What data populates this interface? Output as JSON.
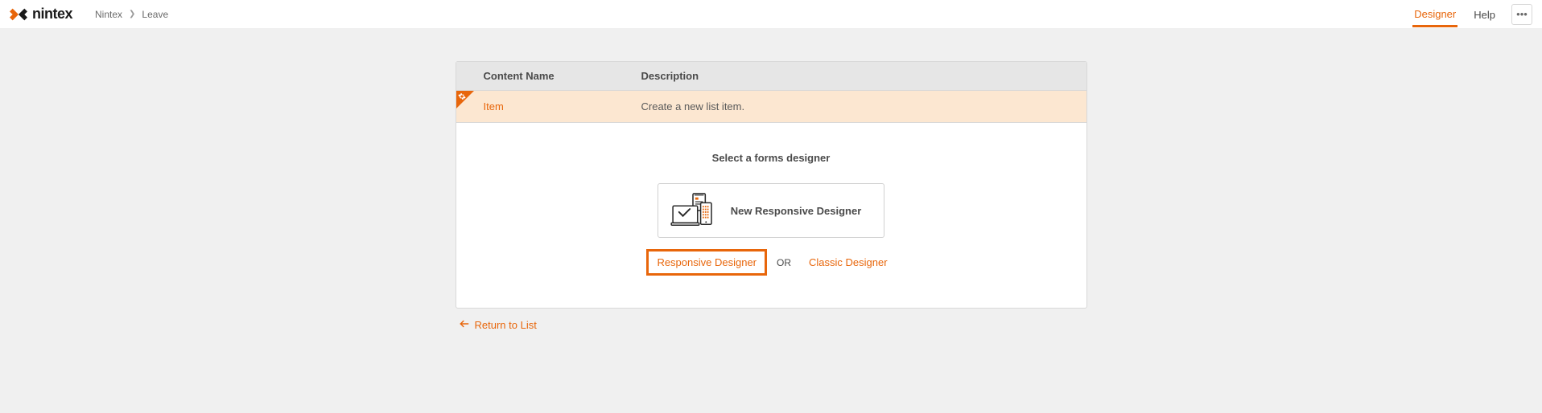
{
  "header": {
    "brand": "nintex",
    "breadcrumb": {
      "root": "Nintex",
      "current": "Leave"
    },
    "nav": {
      "designer": "Designer",
      "help": "Help"
    }
  },
  "table": {
    "headers": {
      "name": "Content Name",
      "description": "Description"
    },
    "row": {
      "name": "Item",
      "description": "Create a new list item."
    }
  },
  "panel": {
    "title": "Select a forms designer",
    "newResponsive": "New Responsive Designer",
    "responsive": "Responsive Designer",
    "or": "OR",
    "classic": "Classic Designer"
  },
  "footer": {
    "return": "Return to List"
  }
}
